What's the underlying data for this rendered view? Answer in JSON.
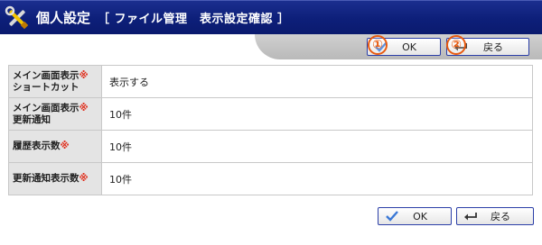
{
  "header": {
    "title": "個人設定",
    "subtitle": "［ ファイル管理　表示設定確認 ］"
  },
  "buttons": {
    "ok_label": "OK",
    "back_label": "戻る"
  },
  "badges": [
    "①",
    "②"
  ],
  "required_mark": "※",
  "rows": [
    {
      "label_line1": "メイン画面表示",
      "label_line2": "ショートカット",
      "value": "表示する"
    },
    {
      "label_line1": "メイン画面表示",
      "label_line2": "更新通知",
      "value": "10件"
    },
    {
      "label_line1": "履歴表示数",
      "label_line2": "",
      "value": "10件"
    },
    {
      "label_line1": "更新通知表示数",
      "label_line2": "",
      "value": "10件"
    }
  ],
  "colors": {
    "header_bg": "#0d1f79",
    "accent_orange": "#e85a10",
    "required_red": "#e0301e",
    "label_bg": "#e4e4e4"
  }
}
